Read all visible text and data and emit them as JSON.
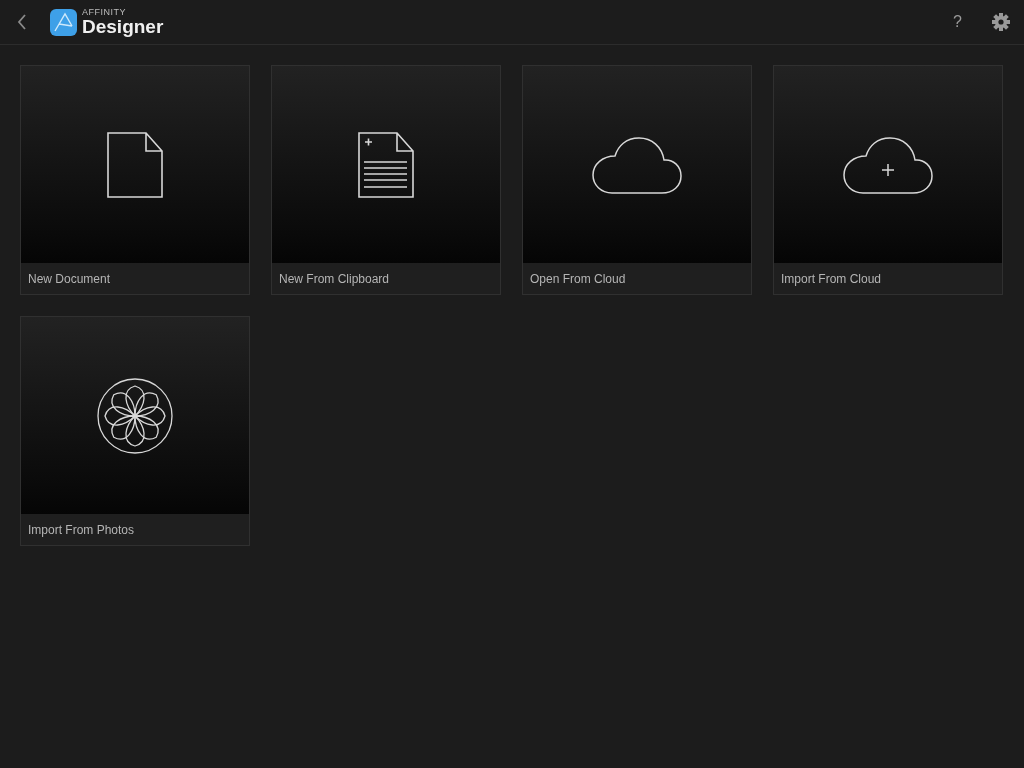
{
  "header": {
    "brand_small": "AFFINITY",
    "brand_name": "Designer",
    "help": "?"
  },
  "tiles": [
    {
      "kind": "document",
      "label": "New Document"
    },
    {
      "kind": "clipboard",
      "label": "New From Clipboard"
    },
    {
      "kind": "cloud",
      "label": "Open From Cloud"
    },
    {
      "kind": "cloud-plus",
      "label": "Import From Cloud"
    },
    {
      "kind": "photos",
      "label": "Import From Photos"
    }
  ]
}
